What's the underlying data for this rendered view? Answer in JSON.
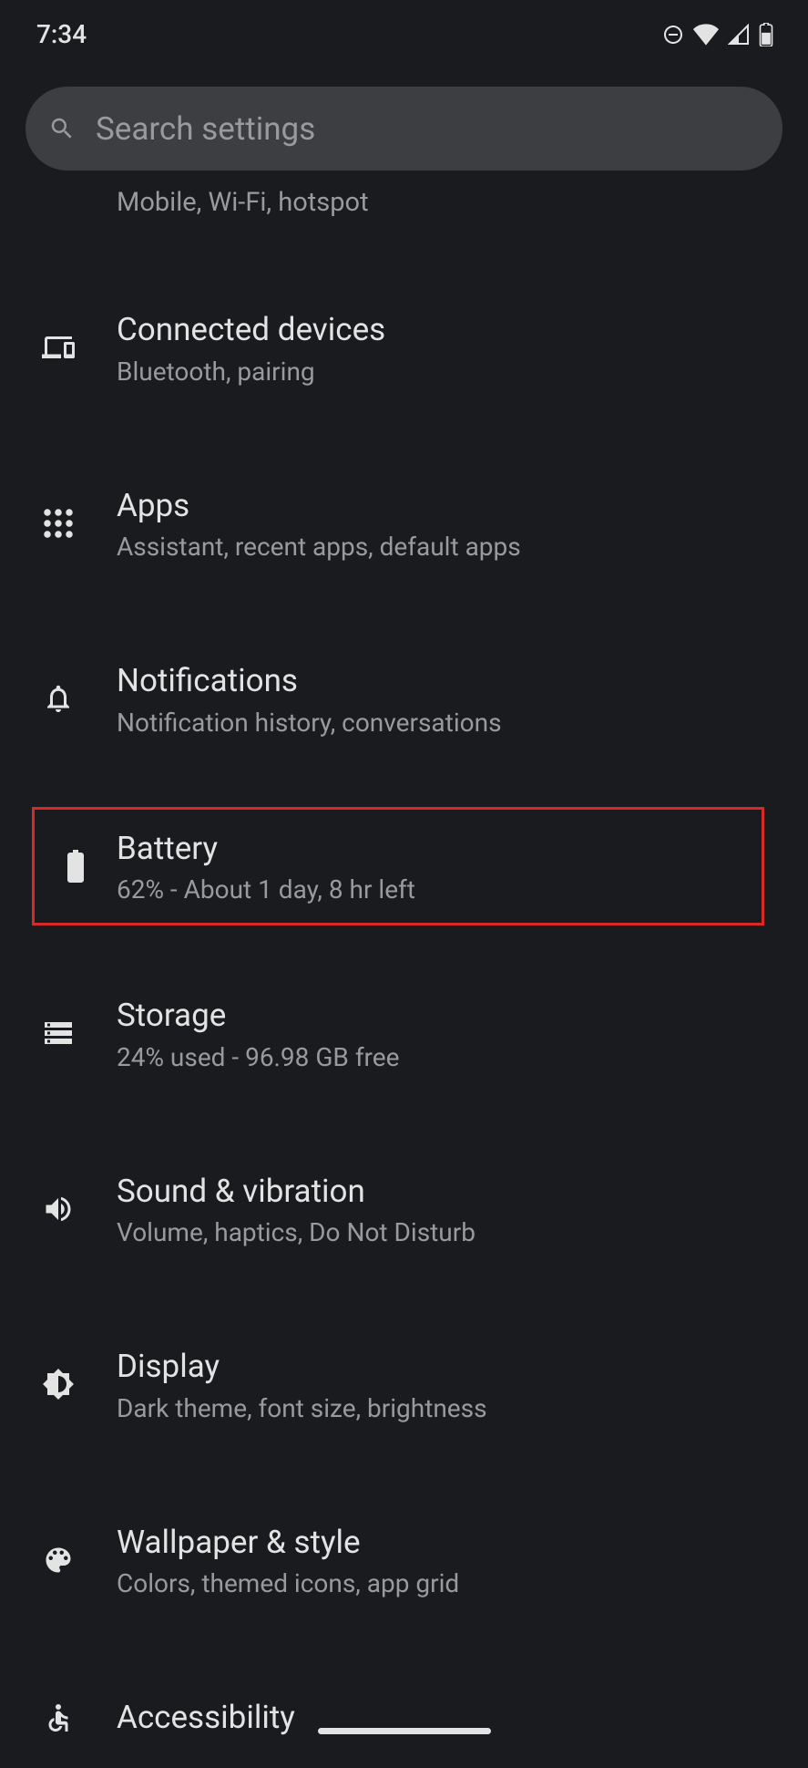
{
  "status": {
    "time": "7:34"
  },
  "search": {
    "placeholder": "Search settings"
  },
  "partial": {
    "subtitle": "Mobile, Wi-Fi, hotspot"
  },
  "items": [
    {
      "title": "Connected devices",
      "subtitle": "Bluetooth, pairing",
      "icon": "devices"
    },
    {
      "title": "Apps",
      "subtitle": "Assistant, recent apps, default apps",
      "icon": "apps"
    },
    {
      "title": "Notifications",
      "subtitle": "Notification history, conversations",
      "icon": "bell"
    },
    {
      "title": "Battery",
      "subtitle": "62% - About 1 day, 8 hr left",
      "icon": "battery",
      "highlighted": true
    },
    {
      "title": "Storage",
      "subtitle": "24% used - 96.98 GB free",
      "icon": "storage"
    },
    {
      "title": "Sound & vibration",
      "subtitle": "Volume, haptics, Do Not Disturb",
      "icon": "sound"
    },
    {
      "title": "Display",
      "subtitle": "Dark theme, font size, brightness",
      "icon": "display"
    },
    {
      "title": "Wallpaper & style",
      "subtitle": "Colors, themed icons, app grid",
      "icon": "palette"
    },
    {
      "title": "Accessibility",
      "subtitle": "",
      "icon": "accessibility"
    }
  ]
}
